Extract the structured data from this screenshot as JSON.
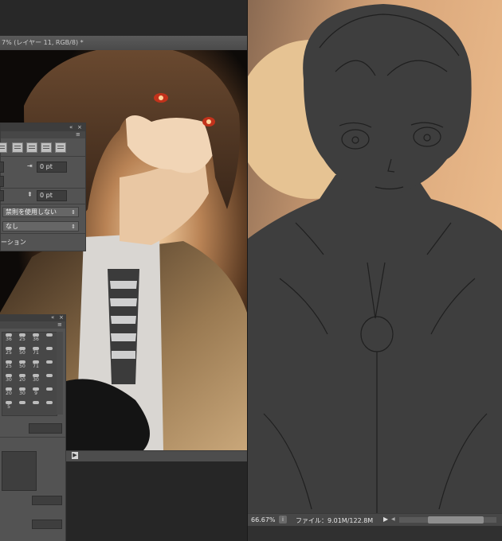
{
  "left_window": {
    "tab_title": "7% (レイヤー 11, RGB/8) *"
  },
  "paragraph_panel": {
    "indent_right_value": "0 pt",
    "space_before_value": "0 pt",
    "kinsoku_select": "禁則を使用しない",
    "mojikumi_select": "なし",
    "hyphenation_label": "ーション"
  },
  "brush_panel": {
    "brush_sizes": [
      "36",
      "25",
      "36",
      "25",
      "50",
      "71",
      "25",
      "50",
      "71",
      "30",
      "20",
      "30",
      "20",
      "30",
      "9",
      "5",
      "",
      "",
      "",
      "",
      ""
    ]
  },
  "right_window": {
    "zoom": "66.67%",
    "file_info": "ファイル：9.01M/122.8M"
  },
  "colors": {
    "ui_dark": "#2b2b2b",
    "panel_gray": "#535353",
    "sketch_background": "#3e3e3e",
    "warm_glow": "#e8b074"
  },
  "icons": {
    "panel_collapse": "double-left-arrow",
    "panel_close": "close",
    "play": "play-triangle",
    "info": "info-circle"
  }
}
